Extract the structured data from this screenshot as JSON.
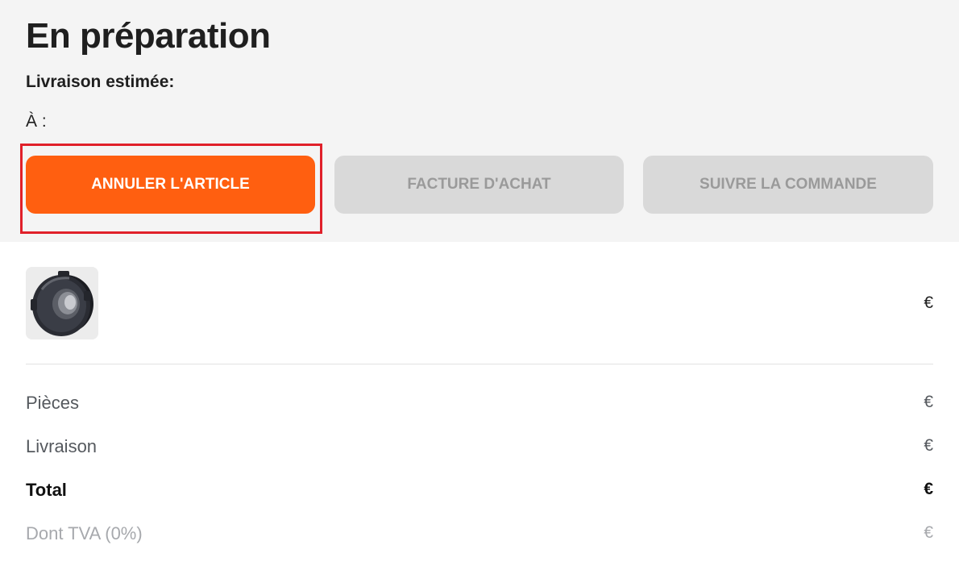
{
  "order": {
    "status": "En préparation",
    "estimated_delivery_label": "Livraison estimée:",
    "to_label": "À :"
  },
  "actions": {
    "cancel_item": "ANNULER L'ARTICLE",
    "purchase_invoice": "FACTURE D'ACHAT",
    "track_order": "SUIVRE LA COMMANDE"
  },
  "item": {
    "image_icon": "product-thumbnail",
    "price": "€"
  },
  "summary": {
    "parts_label": "Pièces",
    "parts_value": "€",
    "shipping_label": "Livraison",
    "shipping_value": "€",
    "total_label": "Total",
    "total_value": "€",
    "vat_label": "Dont TVA (0%)",
    "vat_value": "€"
  },
  "colors": {
    "primary_button": "#ff5f10",
    "disabled_button": "#d9d9d9",
    "highlight_border": "#e0202a",
    "header_background": "#f4f4f4"
  }
}
